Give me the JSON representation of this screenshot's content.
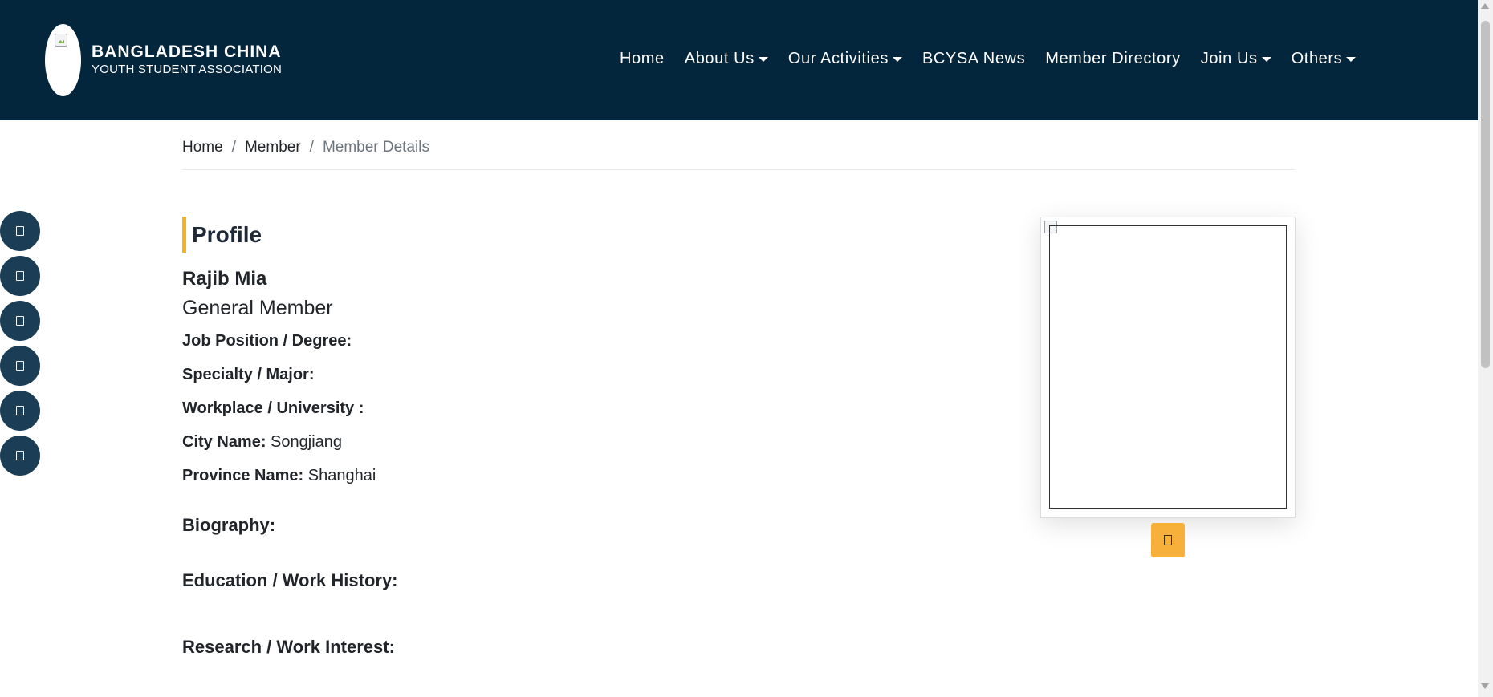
{
  "brand": {
    "title": "BANGLADESH CHINA",
    "subtitle": "YOUTH STUDENT ASSOCIATION",
    "logo_icon": "broken-image-icon"
  },
  "nav": [
    {
      "label": "Home",
      "dropdown": false
    },
    {
      "label": "About Us",
      "dropdown": true
    },
    {
      "label": "Our Activities",
      "dropdown": true
    },
    {
      "label": "BCYSA News",
      "dropdown": false
    },
    {
      "label": "Member Directory",
      "dropdown": false
    },
    {
      "label": "Join Us",
      "dropdown": true
    },
    {
      "label": "Others",
      "dropdown": true
    }
  ],
  "breadcrumb": {
    "items": [
      "Home",
      "Member"
    ],
    "active": "Member Details",
    "separator": "/"
  },
  "social_icons": [
    "facebook-icon",
    "twitter-icon",
    "linkedin-icon",
    "youtube-icon",
    "instagram-icon",
    "wechat-icon"
  ],
  "profile": {
    "heading": "Profile",
    "name": "Rajib Mia",
    "role": "General Member",
    "fields": {
      "job_label": "Job Position / Degree:",
      "job_value": "",
      "specialty_label": "Specialty / Major:",
      "specialty_value": "",
      "workplace_label": "Workplace / University :",
      "workplace_value": "",
      "city_label": "City Name:",
      "city_value": "Songjiang",
      "province_label": "Province Name:",
      "province_value": "Shanghai"
    },
    "sections": {
      "biography": "Biography:",
      "education": "Education / Work History:",
      "research": "Research / Work Interest:"
    }
  },
  "photo": {
    "icon": "broken-image-icon",
    "download_icon": "file-pdf-icon"
  },
  "colors": {
    "header_bg": "#04263d",
    "accent": "#f5b324",
    "button": "#f7b13a",
    "social_bg": "#1b3d55"
  }
}
